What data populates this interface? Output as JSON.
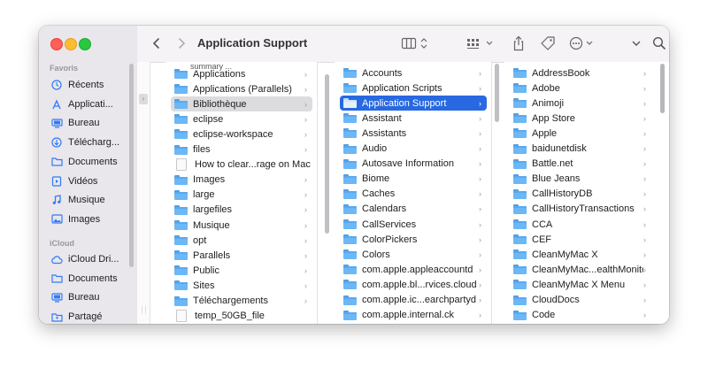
{
  "toolbar": {
    "title": "Application Support",
    "icons": [
      "chevron-left",
      "chevron-right",
      "columns-view",
      "group-grid",
      "share",
      "tag",
      "more-ellipsis",
      "chevron-down",
      "search"
    ]
  },
  "sidebar": {
    "favorites_header": "Favoris",
    "icloud_header": "iCloud",
    "favorites": [
      {
        "label": "Récents",
        "icon": "clock-icon"
      },
      {
        "label": "Applicati...",
        "icon": "applications-icon"
      },
      {
        "label": "Bureau",
        "icon": "desktop-icon"
      },
      {
        "label": "Télécharg...",
        "icon": "download-icon"
      },
      {
        "label": "Documents",
        "icon": "folder-icon"
      },
      {
        "label": "Vidéos",
        "icon": "video-icon"
      },
      {
        "label": "Musique",
        "icon": "music-icon"
      },
      {
        "label": "Images",
        "icon": "photo-icon"
      }
    ],
    "icloud": [
      {
        "label": "iCloud Dri...",
        "icon": "cloud-icon"
      },
      {
        "label": "Documents",
        "icon": "folder-icon"
      },
      {
        "label": "Bureau",
        "icon": "desktop-icon"
      },
      {
        "label": "Partagé",
        "icon": "shared-folder-icon"
      }
    ]
  },
  "column1": {
    "top_partial": "summary ...",
    "items": [
      {
        "label": "Applications",
        "type": "folder"
      },
      {
        "label": "Applications (Parallels)",
        "type": "folder"
      },
      {
        "label": "Bibliothèque",
        "type": "folder",
        "state": "inactive-selected"
      },
      {
        "label": "eclipse",
        "type": "folder"
      },
      {
        "label": "eclipse-workspace",
        "type": "folder"
      },
      {
        "label": "files",
        "type": "folder"
      },
      {
        "label": "How to clear...rage on Mac",
        "type": "file"
      },
      {
        "label": "Images",
        "type": "folder"
      },
      {
        "label": "large",
        "type": "folder"
      },
      {
        "label": "largefiles",
        "type": "folder"
      },
      {
        "label": "Musique",
        "type": "folder"
      },
      {
        "label": "opt",
        "type": "folder"
      },
      {
        "label": "Parallels",
        "type": "folder"
      },
      {
        "label": "Public",
        "type": "folder"
      },
      {
        "label": "Sites",
        "type": "folder"
      },
      {
        "label": "Téléchargements",
        "type": "folder"
      },
      {
        "label": "temp_50GB_file",
        "type": "file"
      }
    ]
  },
  "column2": {
    "items": [
      {
        "label": "Accounts",
        "type": "folder"
      },
      {
        "label": "Application Scripts",
        "type": "folder"
      },
      {
        "label": "Application Support",
        "type": "folder",
        "state": "selected"
      },
      {
        "label": "Assistant",
        "type": "folder"
      },
      {
        "label": "Assistants",
        "type": "folder"
      },
      {
        "label": "Audio",
        "type": "folder"
      },
      {
        "label": "Autosave Information",
        "type": "folder"
      },
      {
        "label": "Biome",
        "type": "folder"
      },
      {
        "label": "Caches",
        "type": "folder"
      },
      {
        "label": "Calendars",
        "type": "folder"
      },
      {
        "label": "CallServices",
        "type": "folder"
      },
      {
        "label": "ColorPickers",
        "type": "folder"
      },
      {
        "label": "Colors",
        "type": "folder"
      },
      {
        "label": "com.apple.appleaccountd",
        "type": "folder"
      },
      {
        "label": "com.apple.bl...rvices.cloud",
        "type": "folder"
      },
      {
        "label": "com.apple.ic...earchpartyd",
        "type": "folder"
      },
      {
        "label": "com.apple.internal.ck",
        "type": "folder"
      }
    ]
  },
  "column3": {
    "items": [
      {
        "label": "AddressBook",
        "type": "folder"
      },
      {
        "label": "Adobe",
        "type": "folder"
      },
      {
        "label": "Animoji",
        "type": "folder"
      },
      {
        "label": "App Store",
        "type": "folder"
      },
      {
        "label": "Apple",
        "type": "folder"
      },
      {
        "label": "baidunetdisk",
        "type": "folder"
      },
      {
        "label": "Battle.net",
        "type": "folder"
      },
      {
        "label": "Blue Jeans",
        "type": "folder"
      },
      {
        "label": "CallHistoryDB",
        "type": "folder"
      },
      {
        "label": "CallHistoryTransactions",
        "type": "folder"
      },
      {
        "label": "CCA",
        "type": "folder"
      },
      {
        "label": "CEF",
        "type": "folder"
      },
      {
        "label": "CleanMyMac X",
        "type": "folder"
      },
      {
        "label": "CleanMyMac...ealthMonitor",
        "type": "folder"
      },
      {
        "label": "CleanMyMac X Menu",
        "type": "folder"
      },
      {
        "label": "CloudDocs",
        "type": "folder"
      },
      {
        "label": "Code",
        "type": "folder"
      }
    ]
  },
  "colors": {
    "accent": "#2869e1",
    "folder": "#6cb7f5",
    "sidebar_icon": "#2f7bf6"
  }
}
